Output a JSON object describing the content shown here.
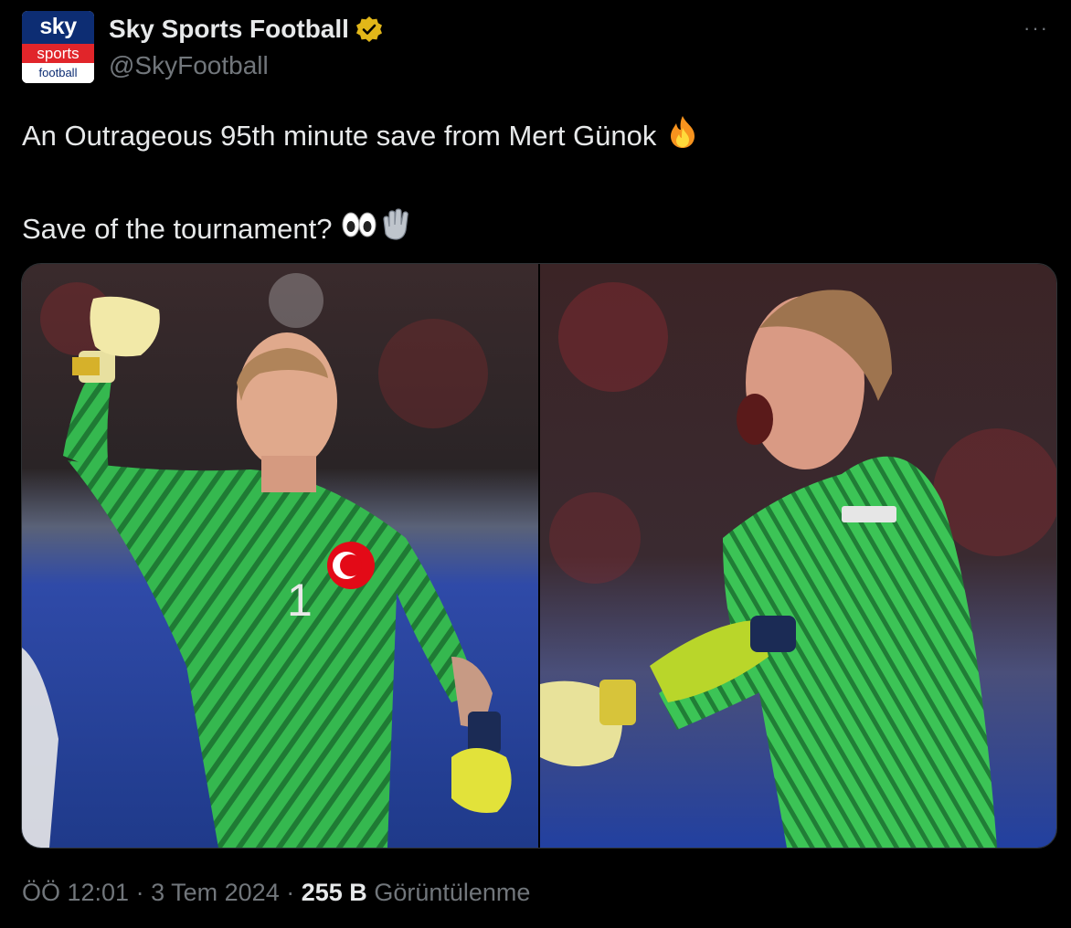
{
  "account": {
    "avatar_lines": [
      "sky",
      "sports",
      "football"
    ],
    "display_name": "Sky Sports Football",
    "handle": "@SkyFootball",
    "verified_color": "#e2b719"
  },
  "menu": {
    "more_label": "···"
  },
  "tweet": {
    "line1": "An Outrageous 95th minute save from Mert Günok",
    "line2": "Save of the tournament?",
    "emoji_line1": "fire-emoji",
    "emoji_line2": [
      "eyes-emoji",
      "goalkeeper-glove-emoji"
    ]
  },
  "media": {
    "images": [
      {
        "name": "goalkeeper-fist-pump-photo",
        "kit_color": "#2fb34a"
      },
      {
        "name": "goalkeeper-celebration-shout-photo",
        "kit_color": "#33c04f"
      }
    ]
  },
  "meta": {
    "time": "ÖÖ 12:01",
    "separator": "·",
    "date": "3 Tem 2024",
    "views_count": "255 B",
    "views_label": "Görüntülenme"
  }
}
